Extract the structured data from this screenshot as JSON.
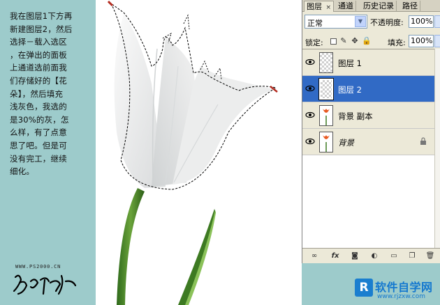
{
  "tutorial": {
    "text": "我在图层1下方再\n新建图层2，然后\n选择－载入选区\n，在弹出的面板\n上通道选前面我\n们存储好的【花\n朵】，然后填充\n浅灰色，我选的\n是30%的灰，怎\n么样，有了点意\n思了吧。但是可\n没有完工，继续\n细化。",
    "site_mark": "WWW.PS2000.CN"
  },
  "panel": {
    "tabs": [
      "图层",
      "通道",
      "历史记录",
      "路径"
    ],
    "tab_close": "×",
    "blend_mode": "正常",
    "opacity_label": "不透明度:",
    "opacity_value": "100%",
    "lock_label": "锁定:",
    "fill_label": "填充:",
    "fill_value": "100%",
    "layers": [
      {
        "name": "图层 1",
        "selected": false
      },
      {
        "name": "图层 2",
        "selected": true
      },
      {
        "name": "背景 副本",
        "selected": false
      },
      {
        "name": "背景",
        "selected": false,
        "locked": true
      }
    ],
    "bottom_tools": [
      "link-icon",
      "fx-icon",
      "mask-icon",
      "adjustment-icon",
      "folder-icon",
      "new-layer-icon",
      "trash-icon"
    ],
    "fx_label": "fx"
  },
  "watermark": {
    "logo_letter": "R",
    "title": "软件自学网",
    "url": "www.rjzxw.com",
    "brand_color": "#1478cf"
  },
  "colors": {
    "background": "#9dcbcb",
    "selection": "#316ac5",
    "panel": "#ece9d8"
  }
}
